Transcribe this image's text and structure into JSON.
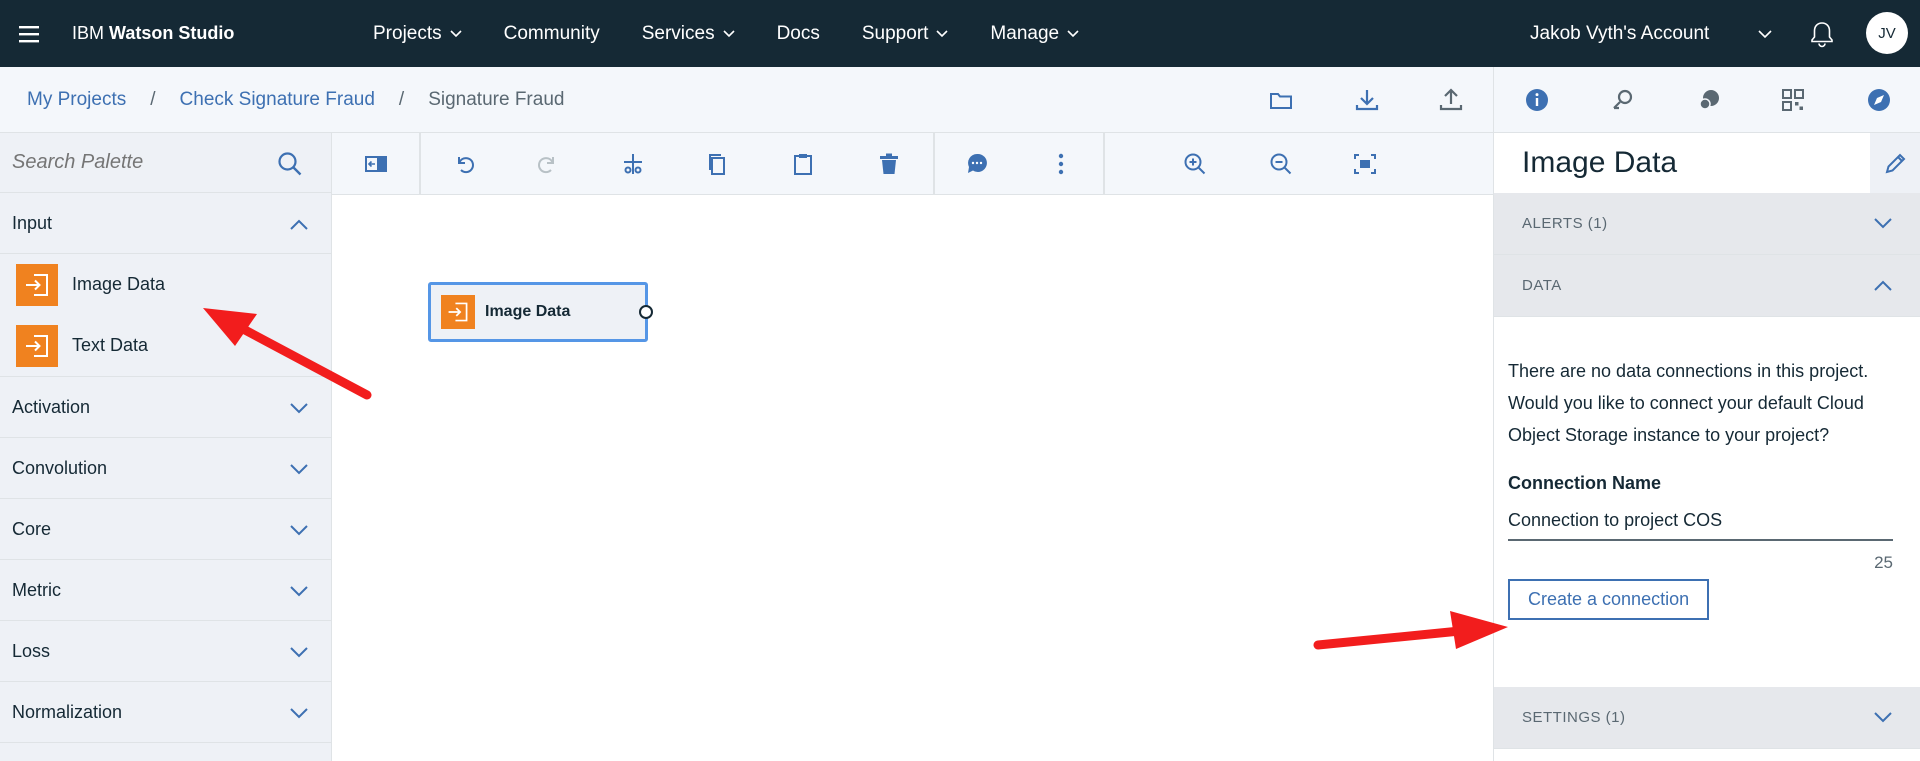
{
  "header": {
    "brand_prefix": "IBM",
    "brand_name": "Watson Studio",
    "nav": [
      {
        "label": "Projects",
        "has_menu": true
      },
      {
        "label": "Community",
        "has_menu": false
      },
      {
        "label": "Services",
        "has_menu": true
      },
      {
        "label": "Docs",
        "has_menu": false
      },
      {
        "label": "Support",
        "has_menu": true
      },
      {
        "label": "Manage",
        "has_menu": true
      }
    ],
    "account": "Jakob Vyth's Account",
    "avatar_initials": "JV"
  },
  "breadcrumb": {
    "items": [
      "My Projects",
      "Check Signature Fraud"
    ],
    "separator": "/",
    "current": "Signature Fraud"
  },
  "palette": {
    "search_placeholder": "Search Palette",
    "input_category": "Input",
    "input_items": [
      "Image Data",
      "Text Data"
    ],
    "categories": [
      "Activation",
      "Convolution",
      "Core",
      "Metric",
      "Loss",
      "Normalization"
    ]
  },
  "canvas": {
    "node_label": "Image Data"
  },
  "properties": {
    "title": "Image Data",
    "alerts_label": "ALERTS (1)",
    "data_label": "DATA",
    "message": "There are no data connections in this project. Would you like to connect your default Cloud Object Storage instance to your project?",
    "connection_name_label": "Connection Name",
    "connection_name_value": "Connection to project COS",
    "char_count": "25",
    "create_button": "Create a connection",
    "settings_label": "SETTINGS (1)"
  },
  "colors": {
    "topbar": "#152935",
    "accent": "#3d70b2",
    "node_orange": "#f0821f",
    "annotation_arrow": "#f21d1d"
  }
}
